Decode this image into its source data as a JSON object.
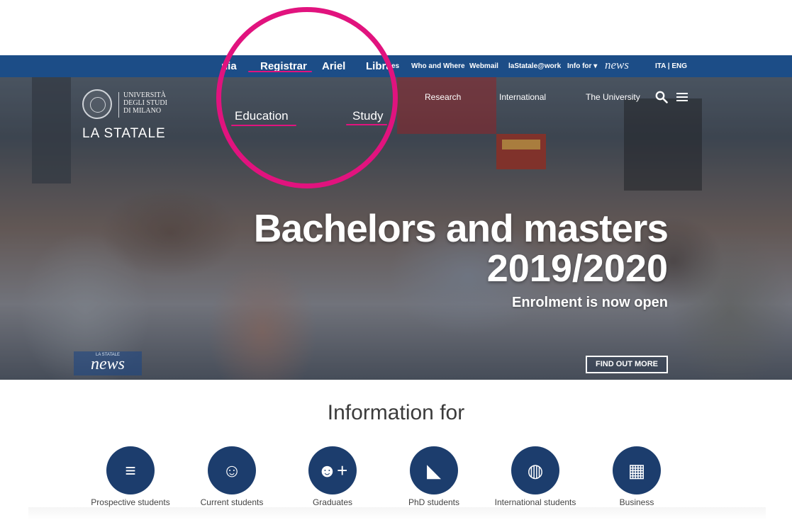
{
  "topbar": {
    "links": [
      "nia",
      "Registrar",
      "Ariel",
      "Libra",
      "es",
      "Who and Where",
      "Webmail",
      "laStatale@work",
      "Info for ▾"
    ],
    "news_logo": "news",
    "lang": "ITA | ENG"
  },
  "logo": {
    "line1": "UNIVERSITÀ",
    "line2": "DEGLI STUDI",
    "line3": "DI MILANO",
    "brand": "LA STATALE"
  },
  "mainnav": {
    "items": [
      "Education",
      "Study",
      "Research",
      "International",
      "The University"
    ]
  },
  "hero": {
    "headline": "Bachelors and masters",
    "year": "2019/2020",
    "subtitle": "Enrolment is now open",
    "cta": "FIND OUT MORE",
    "news_small": "LA STATALE",
    "news_word": "news",
    "poster_text": "■■■■■"
  },
  "colors": {
    "brand_blue": "#1c4d87",
    "icon_navy": "#1c3d6d",
    "highlight_pink": "#e1137e"
  },
  "info": {
    "title": "Information for",
    "items": [
      {
        "label": "Prospective students",
        "icon": "signpost-icon",
        "glyph": "≡"
      },
      {
        "label": "Current students",
        "icon": "user-circle-icon",
        "glyph": "☺"
      },
      {
        "label": "Graduates",
        "icon": "user-plus-icon",
        "glyph": "☻+"
      },
      {
        "label": "PhD students",
        "icon": "graduation-cap-icon",
        "glyph": "◣"
      },
      {
        "label": "International students",
        "icon": "globe-icon",
        "glyph": "◍"
      },
      {
        "label": "Business",
        "icon": "building-icon",
        "glyph": "▦"
      }
    ]
  }
}
